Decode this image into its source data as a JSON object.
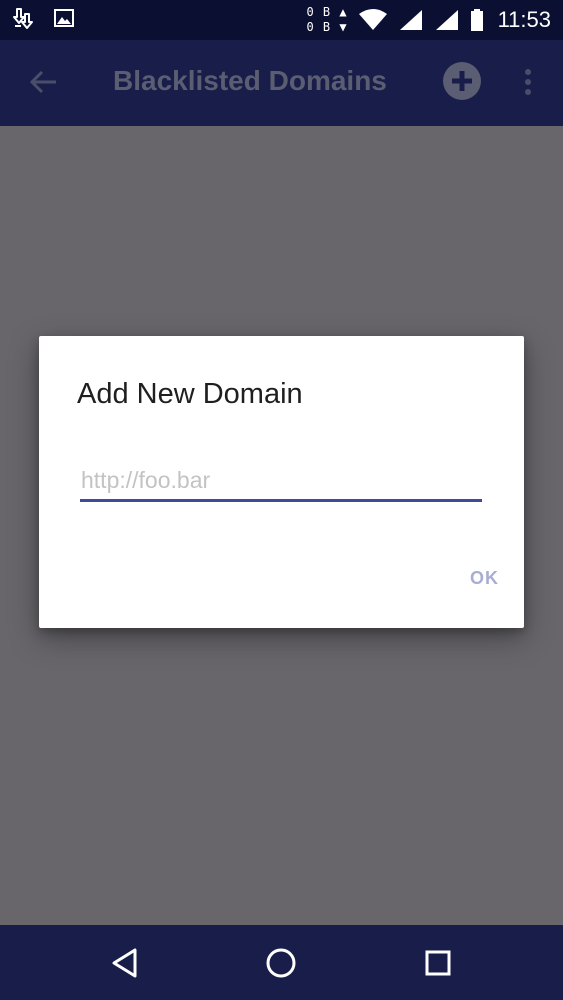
{
  "status_bar": {
    "icons": [
      "download-icon",
      "image-icon"
    ],
    "net_speed_up": "0 B",
    "net_speed_down": "0 B",
    "signal_icons": [
      "wifi-icon",
      "cell-signal-icon",
      "cell-signal-icon",
      "battery-icon"
    ],
    "time": "11:53"
  },
  "app_bar": {
    "title": "Blacklisted Domains",
    "back_icon": "arrow-back-icon",
    "add_icon": "add-circle-icon",
    "more_icon": "more-vert-icon"
  },
  "dialog": {
    "title": "Add New Domain",
    "input_value": "",
    "input_placeholder": "http://foo.bar",
    "ok_label": "OK"
  },
  "nav_bar": {
    "buttons": [
      "back-triangle-icon",
      "home-circle-icon",
      "recents-square-icon"
    ]
  },
  "colors": {
    "status_bar": "#0b1033",
    "app_bar": "#181e49",
    "scrim": "#68666b",
    "accent": "#3f4a9a",
    "ok_disabled": "#a9add3"
  }
}
